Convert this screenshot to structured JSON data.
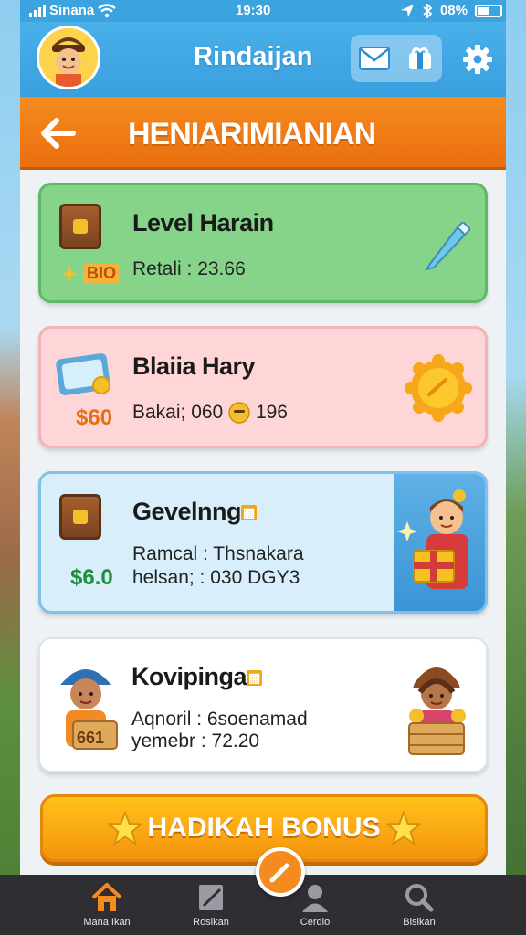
{
  "status_bar": {
    "carrier": "Sinana",
    "time": "19:30",
    "battery": "08%"
  },
  "header": {
    "title": "Rindaijan"
  },
  "title_bar": {
    "title": "HENIARIMIANIAN"
  },
  "cards": [
    {
      "title": "Level Harain",
      "line1": "Retali : 23.66",
      "price": "BIO"
    },
    {
      "title": "Blaiia Hary",
      "line1": "Bakai; 060",
      "line1_suffix": "196",
      "price": "$60"
    },
    {
      "title": "Gevelnng",
      "line1": "Ramcal : Thsnakara",
      "line2": "helsan; : 030 DGY3",
      "price": "$6.0"
    },
    {
      "title": "Kovipinga",
      "line1": "Aqnoril : 6soenamad",
      "line2": "yemebr : 72.20",
      "price": "661"
    }
  ],
  "bonus_button": {
    "label": "HADIKAH BONUS"
  },
  "bottom_nav": [
    {
      "label": "Mana Ikan"
    },
    {
      "label": "Rosikan"
    },
    {
      "label": "Cerdio"
    },
    {
      "label": "Bisikan"
    }
  ],
  "colors": {
    "header": "#3aa3e0",
    "title_bar": "#f58a1f",
    "card_green": "#86d48a",
    "card_pink": "#ffd6d8",
    "card_blue": "#d8eefb",
    "bonus": "#ffc21a"
  }
}
